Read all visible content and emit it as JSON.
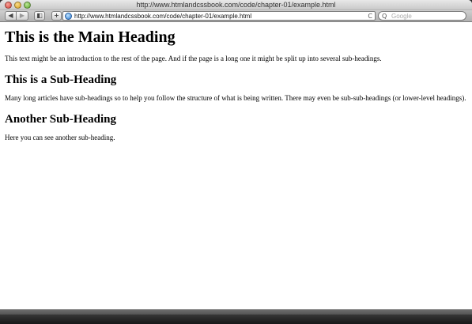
{
  "window": {
    "title": "http://www.htmlandcssbook.com/code/chapter-01/example.html"
  },
  "toolbar": {
    "back_icon": "back-arrow-icon",
    "forward_icon": "forward-arrow-icon",
    "back_glyph": "◀",
    "forward_glyph": "▶",
    "bookmarks_glyph": "◧",
    "add_glyph": "+",
    "url": "http://www.htmlandcssbook.com/code/chapter-01/example.html",
    "reload_glyph": "C",
    "search_glyph": "Q",
    "search_placeholder": "Google"
  },
  "page": {
    "heading": "This is the Main Heading",
    "intro": "This text might be an introduction to the rest of the page. And if the page is a long one it might be split up into several sub-headings.",
    "sub_heading_1": "This is a Sub-Heading",
    "paragraph_1": "Many long articles have sub-headings so to help you follow the structure of what is being written. There may even be sub-sub-headings (or lower-level headings).",
    "sub_heading_2": "Another Sub-Heading",
    "paragraph_2": "Here you can see another sub-heading."
  }
}
